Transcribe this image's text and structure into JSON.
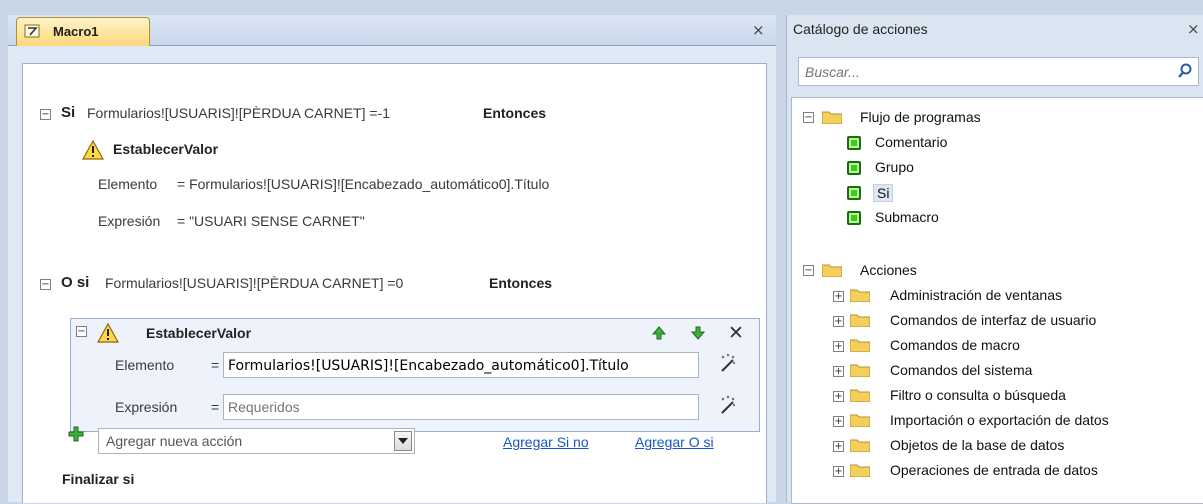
{
  "macro_panel": {
    "tab_label": "Macro1",
    "close_glyph": "×",
    "if_block": {
      "keyword": "Si",
      "condition": "Formularios![USUARIS]![PÈRDUA CARNET] =-1",
      "then_keyword": "Entonces",
      "action_name": "EstablecerValor",
      "element_label": "Elemento",
      "element_value": "= Formularios![USUARIS]![Encabezado_automático0].Título",
      "expression_label": "Expresión",
      "expression_value": "= \"USUARI SENSE CARNET\""
    },
    "elseif_block": {
      "keyword": "O si",
      "condition": "Formularios![USUARIS]![PÈRDUA CARNET] =0",
      "then_keyword": "Entonces",
      "action_name": "EstablecerValor",
      "element_label": "Elemento",
      "equals": "=",
      "element_value": "Formularios![USUARIS]![Encabezado_automático0].Título",
      "expression_label": "Expresión",
      "expression_placeholder": "Requeridos"
    },
    "add_action_placeholder": "Agregar nueva acción",
    "add_else_link": "Agregar Si no",
    "add_elseif_link": "Agregar O si",
    "end_if": "Finalizar si"
  },
  "catalog": {
    "title": "Catálogo de acciones",
    "close_glyph": "×",
    "search_placeholder": "Buscar...",
    "program_flow": {
      "label": "Flujo de programas",
      "items": [
        "Comentario",
        "Grupo",
        "Si",
        "Submacro"
      ]
    },
    "actions": {
      "label": "Acciones",
      "items": [
        "Administración de ventanas",
        "Comandos de interfaz de usuario",
        "Comandos de macro",
        "Comandos del sistema",
        "Filtro o consulta o búsqueda",
        "Importación o exportación de datos",
        "Objetos de la base de datos",
        "Operaciones de entrada de datos"
      ]
    }
  },
  "colors": {
    "link": "#1a56c8",
    "tab_active": "#ffd77a",
    "green_icon": "#3ecb1c"
  }
}
